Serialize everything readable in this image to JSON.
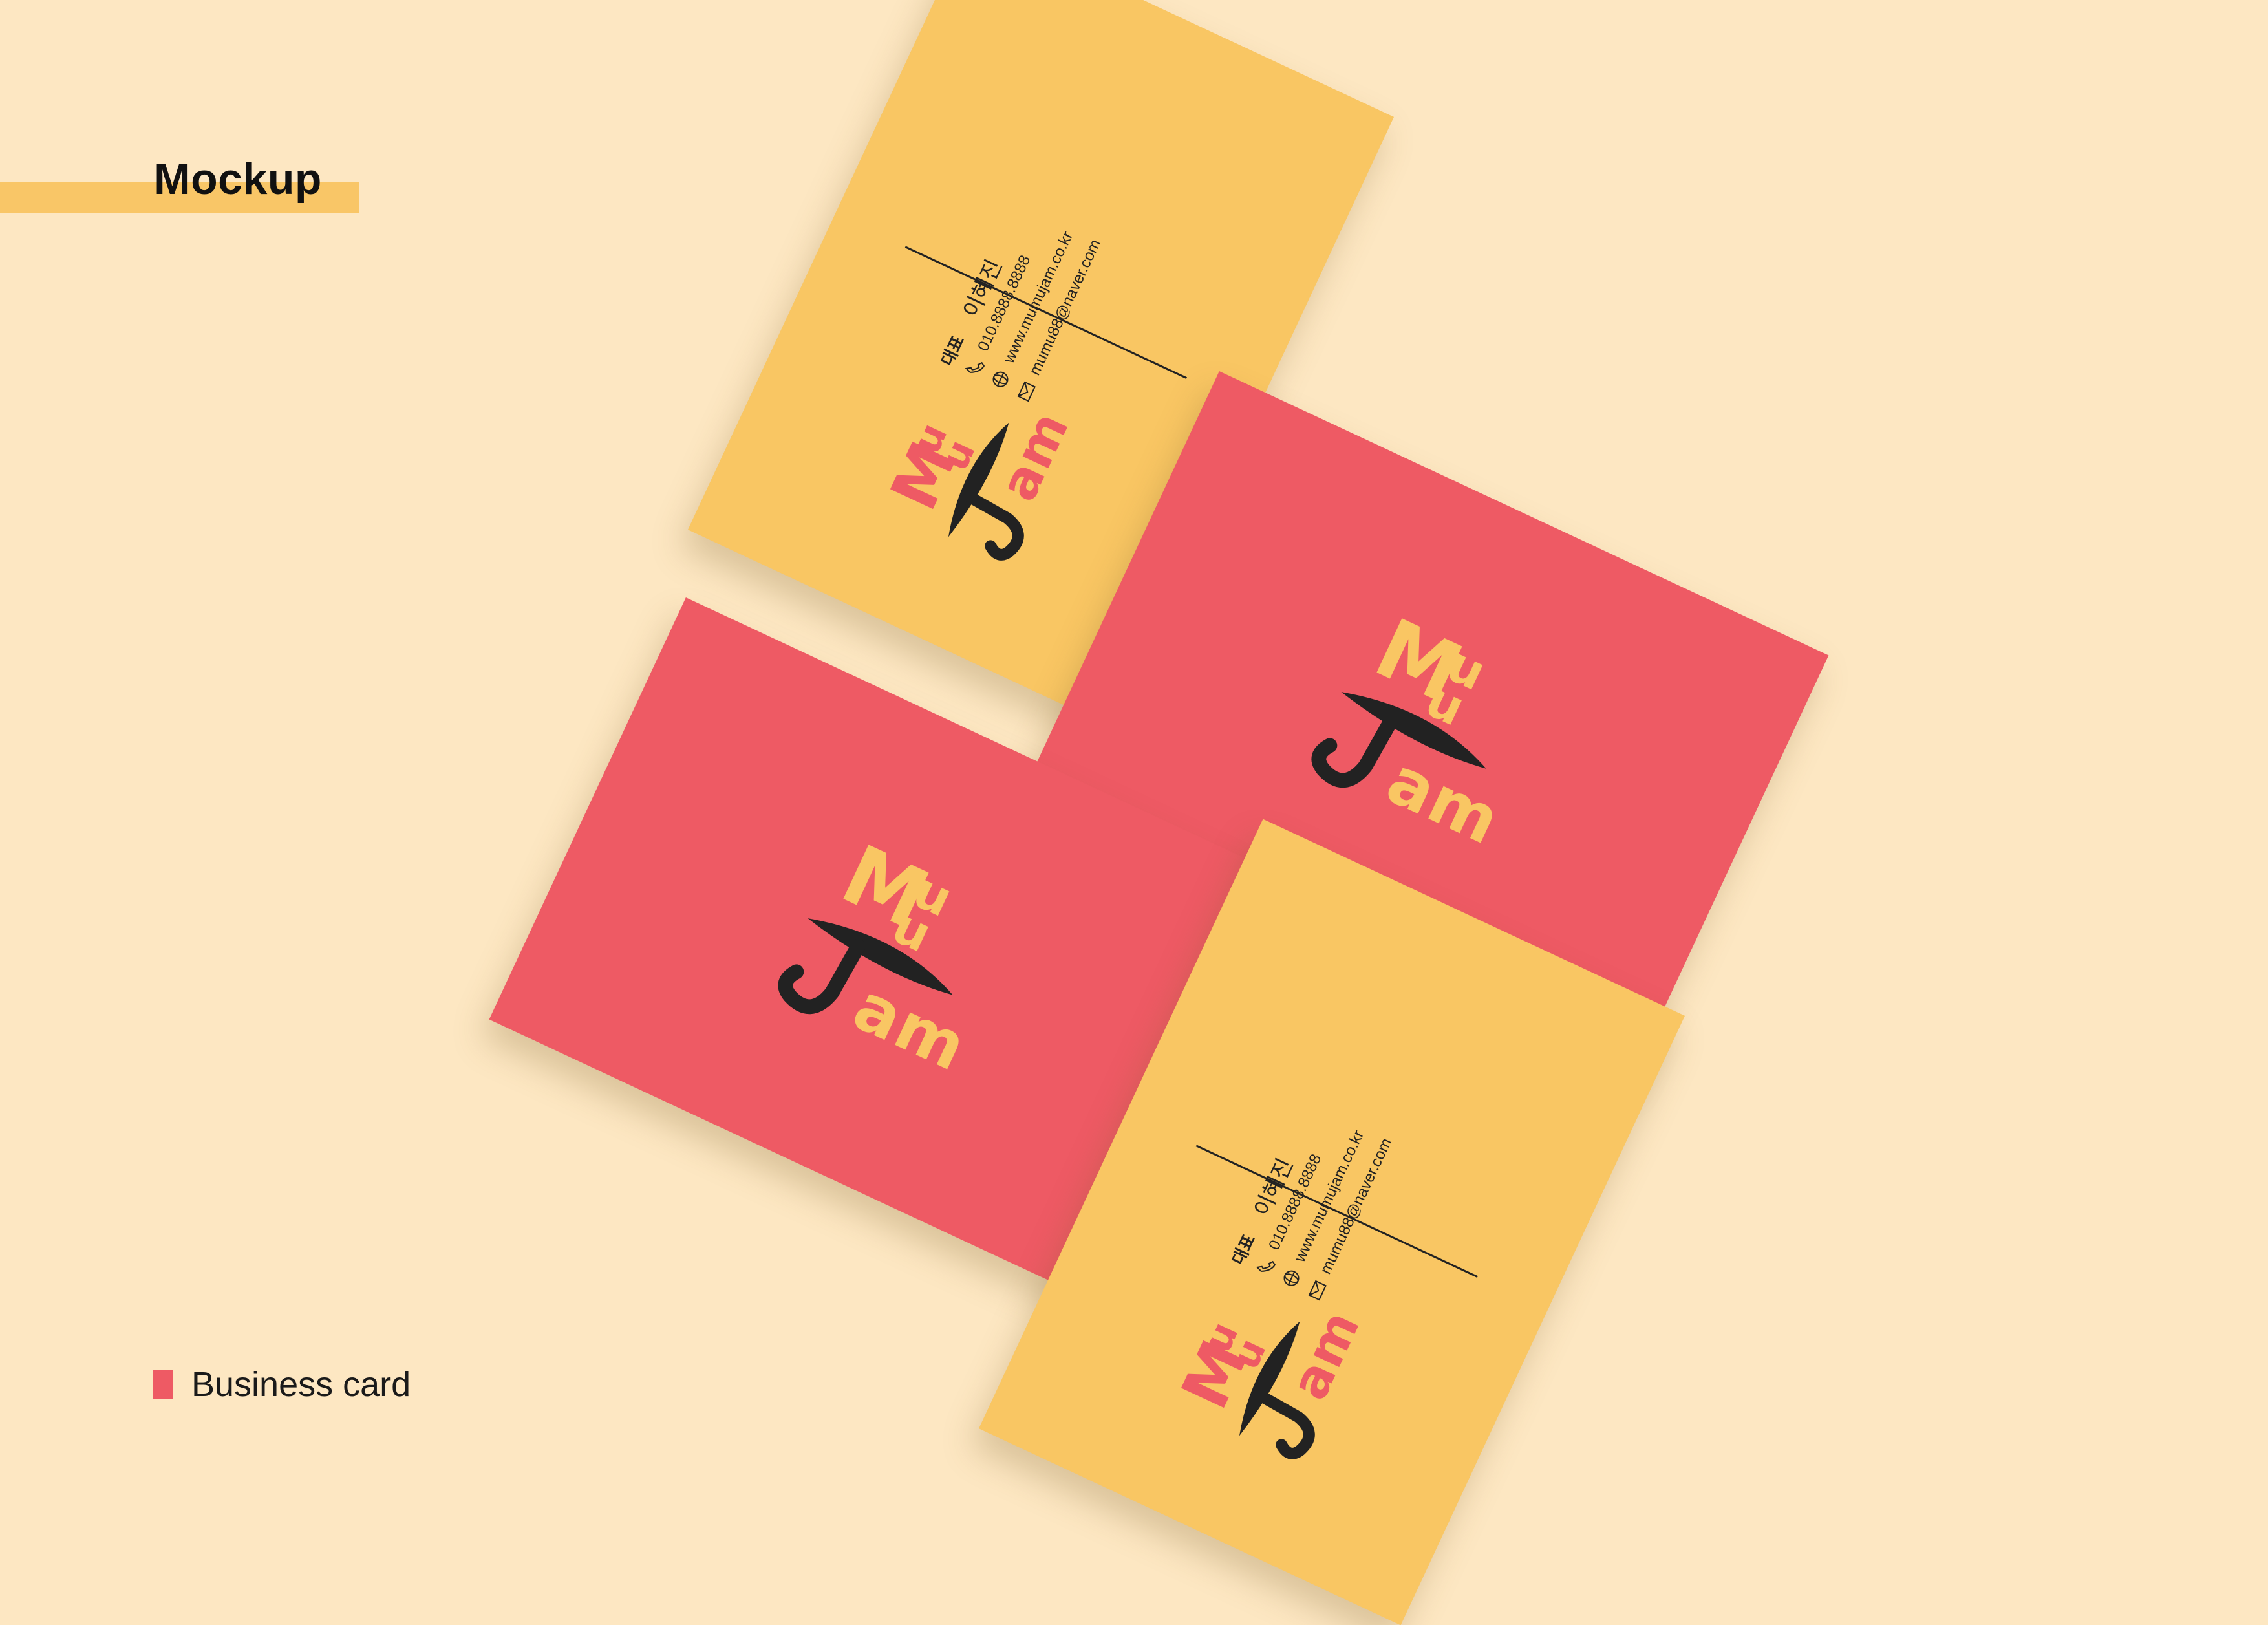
{
  "page": {
    "title": "Mockup",
    "caption": "Business card"
  },
  "colors": {
    "background": "#FDE7C2",
    "accent_yellow": "#F9C663",
    "accent_pink": "#EE5A64",
    "ink": "#222222"
  },
  "logo": {
    "letters_top": [
      "M",
      "u",
      "u"
    ],
    "letters_bottom": [
      "J",
      "a",
      "m"
    ]
  },
  "card_back": {
    "role": "대표",
    "name": "이혜진",
    "phone": "010.8888.8888",
    "website": "www.mumujam.co.kr",
    "email": "mumu88@naver.com",
    "icons": [
      "phone-icon",
      "globe-icon",
      "mail-icon"
    ]
  }
}
